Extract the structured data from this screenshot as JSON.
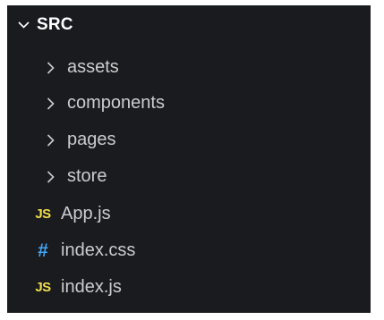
{
  "explorer": {
    "section_title": "SRC",
    "folders": [
      {
        "label": "assets"
      },
      {
        "label": "components"
      },
      {
        "label": "pages"
      },
      {
        "label": "store"
      }
    ],
    "files": [
      {
        "label": "App.js",
        "icon_text": "JS",
        "icon": "js-file-icon",
        "icon_color": "#f1dd4b"
      },
      {
        "label": "index.css",
        "icon_text": "#",
        "icon": "css-file-icon",
        "icon_color": "#42a5f5"
      },
      {
        "label": "index.js",
        "icon_text": "JS",
        "icon": "js-file-icon",
        "icon_color": "#f1dd4b"
      }
    ]
  },
  "colors": {
    "background": "#191b1f",
    "text": "#cccccc",
    "header_text": "#ffffff"
  }
}
